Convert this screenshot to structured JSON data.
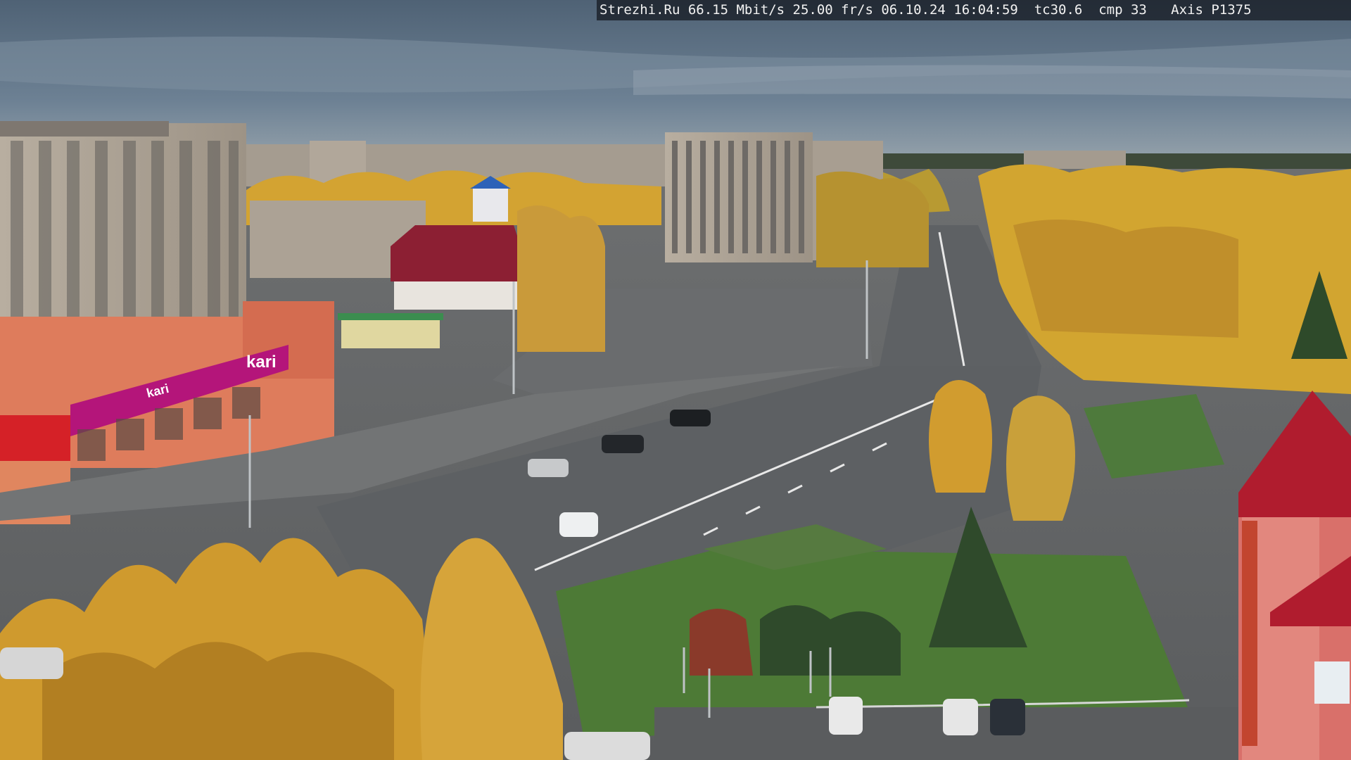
{
  "osd": {
    "text": "Strezhi.Ru 66.15 Mbit/s 25.00 fr/s 06.10.24 16:04:59  tc30.6  cmp 33   Axis P1375"
  },
  "signage": {
    "store_brand": "kari",
    "store_brand_small": "kari"
  },
  "colors": {
    "sky": "#5f7488",
    "road": "#5d6063",
    "foliage_autumn": "#d4a233",
    "storefront": "#e07a5a",
    "brand_magenta": "#b4157a",
    "roof_red": "#b01c2e"
  }
}
